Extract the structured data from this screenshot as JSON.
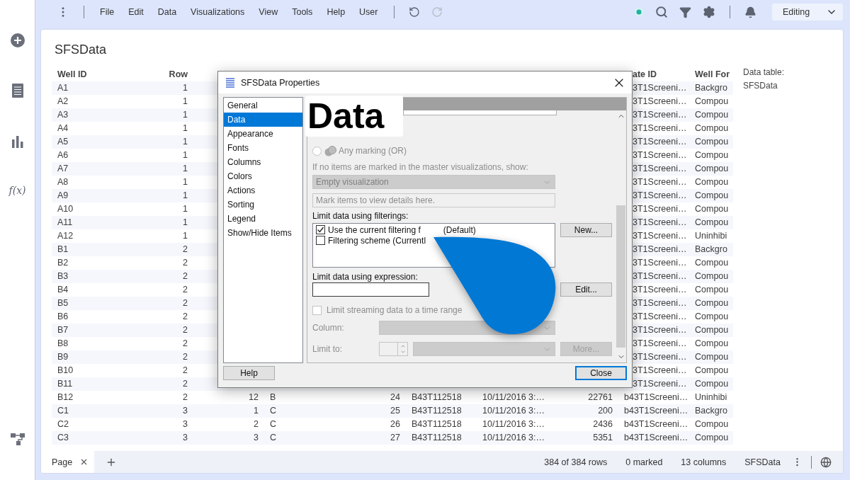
{
  "sidebar": {
    "function_label": "f(x)"
  },
  "menu": [
    "File",
    "Edit",
    "Data",
    "Visualizations",
    "View",
    "Tools",
    "Help",
    "User"
  ],
  "undo": {
    "disabled": false
  },
  "redo": {
    "disabled": true
  },
  "mode": "Editing",
  "page_title": "SFSData",
  "table": {
    "headers": {
      "well_id": "Well ID",
      "row": "Row",
      "column_9": "ate ID",
      "column_10": "Well For"
    },
    "rows": [
      {
        "well_id": "A1",
        "row": "1",
        "column_9": "3T1Screeni…",
        "column_10": "Backgro"
      },
      {
        "well_id": "A2",
        "row": "1",
        "column_9": "3T1Screeni…",
        "column_10": "Compou"
      },
      {
        "well_id": "A3",
        "row": "1",
        "column_9": "3T1Screeni…",
        "column_10": "Compou"
      },
      {
        "well_id": "A4",
        "row": "1",
        "column_9": "3T1Screeni…",
        "column_10": "Compou"
      },
      {
        "well_id": "A5",
        "row": "1",
        "column_9": "3T1Screeni…",
        "column_10": "Compou"
      },
      {
        "well_id": "A6",
        "row": "1",
        "column_9": "3T1Screeni…",
        "column_10": "Compou"
      },
      {
        "well_id": "A7",
        "row": "1",
        "column_9": "3T1Screeni…",
        "column_10": "Compou"
      },
      {
        "well_id": "A8",
        "row": "1",
        "column_9": "3T1Screeni…",
        "column_10": "Compou"
      },
      {
        "well_id": "A9",
        "row": "1",
        "column_9": "3T1Screeni…",
        "column_10": "Compou"
      },
      {
        "well_id": "A10",
        "row": "1",
        "column_9": "3T1Screeni…",
        "column_10": "Compou"
      },
      {
        "well_id": "A11",
        "row": "1",
        "column_9": "3T1Screeni…",
        "column_10": "Compou"
      },
      {
        "well_id": "A12",
        "row": "1",
        "column_9": "3T1Screeni…",
        "column_10": "Uninhibi"
      },
      {
        "well_id": "B1",
        "row": "2",
        "column_9": "3T1Screeni…",
        "column_10": "Backgro"
      },
      {
        "well_id": "B2",
        "row": "2",
        "column_9": "3T1Screeni…",
        "column_10": "Compou"
      },
      {
        "well_id": "B3",
        "row": "2",
        "column_9": "3T1Screeni…",
        "column_10": "Compou"
      },
      {
        "well_id": "B4",
        "row": "2",
        "column_9": "3T1Screeni…",
        "column_10": "Compou"
      },
      {
        "well_id": "B5",
        "row": "2",
        "column_9": "3T1Screeni…",
        "column_10": "Compou"
      },
      {
        "well_id": "B6",
        "row": "2",
        "column_9": "3T1Screeni…",
        "column_10": "Compou"
      },
      {
        "well_id": "B7",
        "row": "2",
        "column_9": "3T1Screeni…",
        "column_10": "Compou"
      },
      {
        "well_id": "B8",
        "row": "2",
        "column_9": "3T1Screeni…",
        "column_10": "Compou"
      },
      {
        "well_id": "B9",
        "row": "2",
        "column_9": "3T1Screeni…",
        "column_10": "Compou"
      },
      {
        "well_id": "B10",
        "row": "2",
        "column_9": "3T1Screeni…",
        "column_10": "Compou"
      },
      {
        "well_id": "B11",
        "row": "2",
        "column_9": "3T1Screeni…",
        "column_10": "Compou"
      },
      {
        "well_id": "B12",
        "row": "2",
        "column_3": "12",
        "column_4": "B",
        "column_5": "24",
        "column_6": "B43T112518",
        "column_7": "10/11/2016 3:…",
        "column_8": "22761",
        "column_9": "b43T1Screeni…",
        "column_10": "Uninhibi"
      },
      {
        "well_id": "C1",
        "row": "3",
        "column_3": "1",
        "column_4": "C",
        "column_5": "25",
        "column_6": "B43T112518",
        "column_7": "10/11/2016 3:…",
        "column_8": "200",
        "column_9": "b43T1Screeni…",
        "column_10": "Backgro"
      },
      {
        "well_id": "C2",
        "row": "3",
        "column_3": "2",
        "column_4": "C",
        "column_5": "26",
        "column_6": "B43T112518",
        "column_7": "10/11/2016 3:…",
        "column_8": "2436",
        "column_9": "b43T1Screeni…",
        "column_10": "Compou"
      },
      {
        "well_id": "C3",
        "row": "3",
        "column_3": "3",
        "column_4": "C",
        "column_5": "27",
        "column_6": "B43T112518",
        "column_7": "10/11/2016 3:…",
        "column_8": "5351",
        "column_9": "b43T1Screeni…",
        "column_10": "Compou"
      }
    ]
  },
  "side_panel": {
    "label": "Data table:",
    "value": "SFSData"
  },
  "tabs": [
    {
      "label": "Page",
      "selected": true
    }
  ],
  "status": [
    "384 of 384 rows",
    "0 marked",
    "13 columns",
    "SFSData"
  ],
  "dialog": {
    "title": "SFSData Properties",
    "nav": [
      {
        "label": "General",
        "selected": false
      },
      {
        "label": "Data",
        "selected": true
      },
      {
        "label": "Appearance",
        "selected": false
      },
      {
        "label": "Fonts",
        "selected": false
      },
      {
        "label": "Columns",
        "selected": false
      },
      {
        "label": "Colors",
        "selected": false
      },
      {
        "label": "Actions",
        "selected": false
      },
      {
        "label": "Sorting",
        "selected": false
      },
      {
        "label": "Legend",
        "selected": false
      },
      {
        "label": "Show/Hide Items",
        "selected": false
      }
    ],
    "callout": "Data",
    "marking_option": {
      "label": "Any marking (OR)",
      "selected": false,
      "disabled": true
    },
    "empty_prompt": "If no items are marked in the master visualizations, show:",
    "empty_select": {
      "value": "Empty visualization",
      "disabled": true
    },
    "details_field": {
      "placeholder": "Mark items to view details here.",
      "disabled": true
    },
    "filterings_label": "Limit data using filterings:",
    "filterings": [
      {
        "label": "Use the current filtering f",
        "suffix": "(Default)",
        "checked": true
      },
      {
        "label": "Filtering scheme (Currentl",
        "checked": false
      }
    ],
    "new_button": {
      "label": "New...",
      "disabled": false
    },
    "expression_label": "Limit data using expression:",
    "edit_button": {
      "label": "Edit...",
      "disabled": false
    },
    "streaming": {
      "label": "Limit streaming data to a time range",
      "checked": false,
      "disabled": true
    },
    "column_label": "Column:",
    "limit_label": "Limit to:",
    "more_button": {
      "label": "More...",
      "disabled": true
    },
    "help_button": "Help",
    "close_button": "Close"
  }
}
